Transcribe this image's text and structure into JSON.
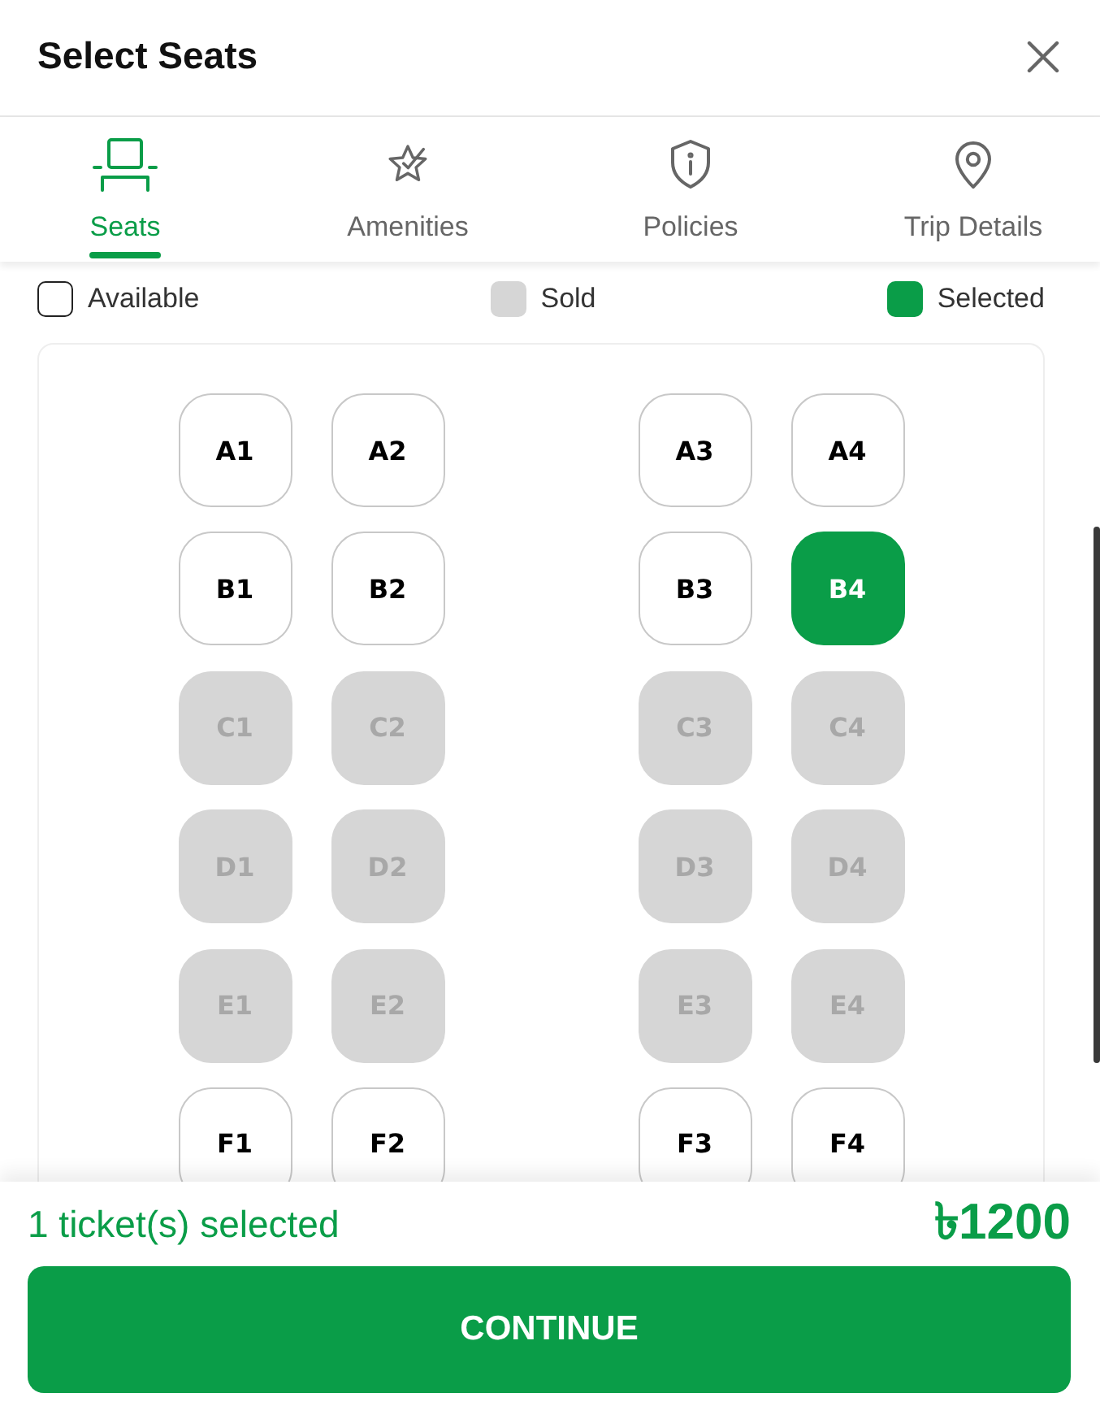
{
  "header": {
    "title": "Select Seats"
  },
  "tabs": [
    {
      "label": "Seats",
      "selected": true
    },
    {
      "label": "Amenities",
      "selected": false
    },
    {
      "label": "Policies",
      "selected": false
    },
    {
      "label": "Trip Details",
      "selected": false
    }
  ],
  "legend": [
    {
      "kind": "available",
      "label": "Available"
    },
    {
      "kind": "sold",
      "label": "Sold"
    },
    {
      "kind": "selected",
      "label": "Selected"
    }
  ],
  "seat_rows": [
    {
      "seats": [
        {
          "label": "A1",
          "sold": false,
          "selected": false
        },
        {
          "label": "A2",
          "sold": false,
          "selected": false
        },
        {
          "label": "A3",
          "sold": false,
          "selected": false
        },
        {
          "label": "A4",
          "sold": false,
          "selected": false
        }
      ]
    },
    {
      "seats": [
        {
          "label": "B1",
          "sold": false,
          "selected": false
        },
        {
          "label": "B2",
          "sold": false,
          "selected": false
        },
        {
          "label": "B3",
          "sold": false,
          "selected": false
        },
        {
          "label": "B4",
          "sold": false,
          "selected": true
        }
      ]
    },
    {
      "seats": [
        {
          "label": "C1",
          "sold": true,
          "selected": false
        },
        {
          "label": "C2",
          "sold": true,
          "selected": false
        },
        {
          "label": "C3",
          "sold": true,
          "selected": false
        },
        {
          "label": "C4",
          "sold": true,
          "selected": false
        }
      ]
    },
    {
      "seats": [
        {
          "label": "D1",
          "sold": true,
          "selected": false
        },
        {
          "label": "D2",
          "sold": true,
          "selected": false
        },
        {
          "label": "D3",
          "sold": true,
          "selected": false
        },
        {
          "label": "D4",
          "sold": true,
          "selected": false
        }
      ]
    },
    {
      "seats": [
        {
          "label": "E1",
          "sold": true,
          "selected": false
        },
        {
          "label": "E2",
          "sold": true,
          "selected": false
        },
        {
          "label": "E3",
          "sold": true,
          "selected": false
        },
        {
          "label": "E4",
          "sold": true,
          "selected": false
        }
      ]
    },
    {
      "seats": [
        {
          "label": "F1",
          "sold": false,
          "selected": false
        },
        {
          "label": "F2",
          "sold": false,
          "selected": false
        },
        {
          "label": "F3",
          "sold": false,
          "selected": false
        },
        {
          "label": "F4",
          "sold": false,
          "selected": false
        }
      ]
    }
  ],
  "footer": {
    "summary": "1 ticket(s) selected",
    "total": "৳1200",
    "button": "CONTINUE"
  }
}
